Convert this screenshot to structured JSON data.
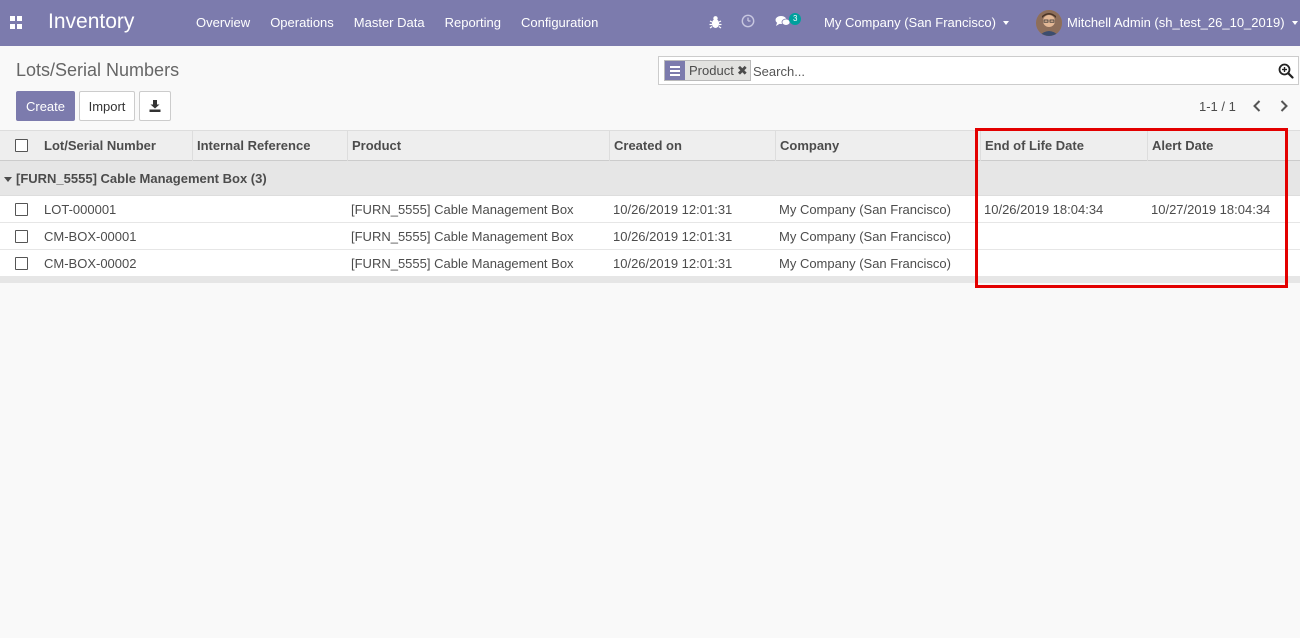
{
  "navbar": {
    "app_title": "Inventory",
    "menu": [
      "Overview",
      "Operations",
      "Master Data",
      "Reporting",
      "Configuration"
    ],
    "messages_count": "3",
    "company": "My Company (San Francisco)",
    "user": "Mitchell Admin (sh_test_26_10_2019)",
    "icons": [
      "apps-icon",
      "bug-icon",
      "clock-icon",
      "chat-icon",
      "avatar"
    ],
    "colors": {
      "brand": "#7c7bad",
      "badge": "#00a09d",
      "highlight": "#e30000"
    }
  },
  "control_panel": {
    "breadcrumb": "Lots/Serial Numbers",
    "search": {
      "facet": "Product",
      "placeholder": "Search..."
    },
    "buttons": {
      "create": "Create",
      "import": "Import"
    },
    "pager": "1-1 / 1"
  },
  "list": {
    "columns": [
      "Lot/Serial Number",
      "Internal Reference",
      "Product",
      "Created on",
      "Company",
      "End of Life Date",
      "Alert Date"
    ],
    "group": "[FURN_5555] Cable Management Box (3)",
    "rows": [
      {
        "lot": "LOT-000001",
        "ref": "",
        "product": "[FURN_5555] Cable Management Box",
        "created": "10/26/2019 12:01:31",
        "company": "My Company (San Francisco)",
        "eol": "10/26/2019 18:04:34",
        "alert": "10/27/2019 18:04:34"
      },
      {
        "lot": "CM-BOX-00001",
        "ref": "",
        "product": "[FURN_5555] Cable Management Box",
        "created": "10/26/2019 12:01:31",
        "company": "My Company (San Francisco)",
        "eol": "",
        "alert": ""
      },
      {
        "lot": "CM-BOX-00002",
        "ref": "",
        "product": "[FURN_5555] Cable Management Box",
        "created": "10/26/2019 12:01:31",
        "company": "My Company (San Francisco)",
        "eol": "",
        "alert": ""
      }
    ]
  }
}
